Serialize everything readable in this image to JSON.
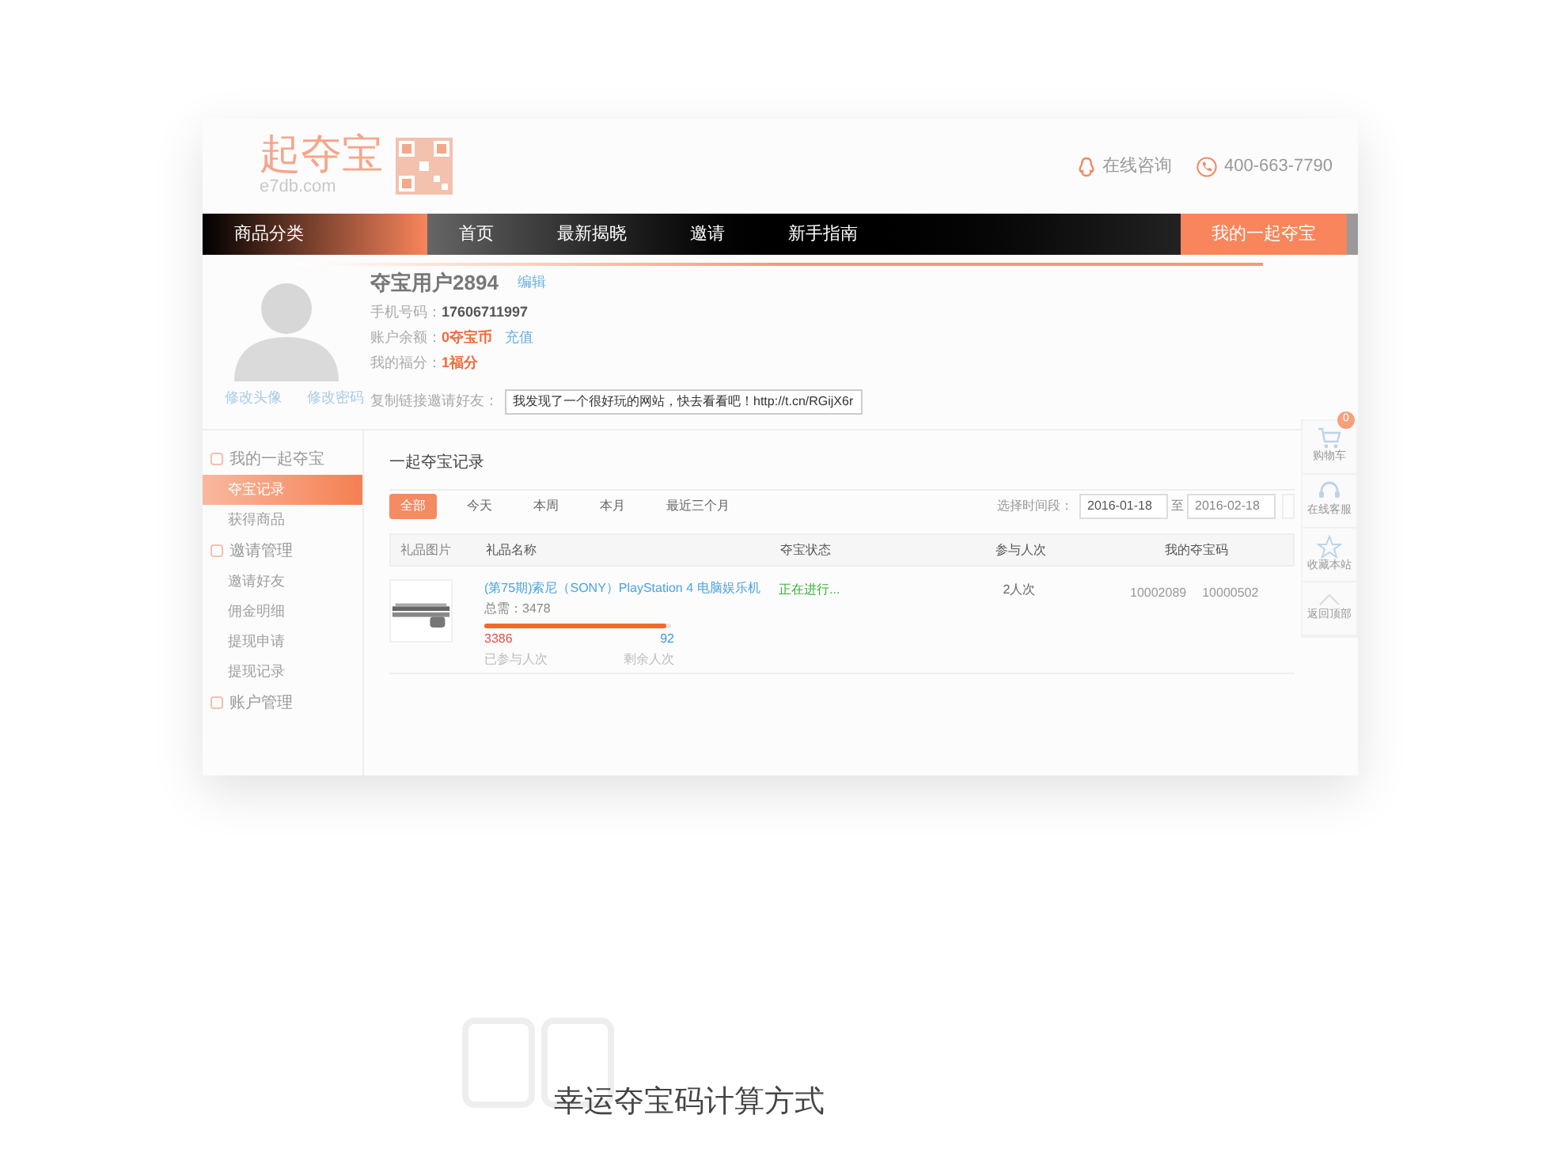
{
  "header": {
    "logo_text": "起夺宝",
    "logo_domain": "e7db.com",
    "consult": "在线咨询",
    "phone": "400-663-7790"
  },
  "nav": {
    "category": "商品分类",
    "items": [
      {
        "label": "首页"
      },
      {
        "label": "最新揭晓"
      },
      {
        "label": "邀请"
      },
      {
        "label": "新手指南"
      }
    ],
    "account": "我的一起夺宝"
  },
  "profile": {
    "username": "夺宝用户2894",
    "edit": "编辑",
    "avatar_links": [
      "修改头像",
      "修改密码"
    ],
    "fields": [
      {
        "kind": "plain",
        "label": "手机号码：",
        "value": "17606711997"
      },
      {
        "kind": "link",
        "label": "账户余额：",
        "value": "0夺宝币",
        "link": "充值"
      },
      {
        "kind": "accent",
        "label": "我的福分：",
        "value": "1福分"
      }
    ],
    "invite_label": "复制链接邀请好友：",
    "invite_value": "我发现了一个很好玩的网站，快去看看吧！http://t.cn/RGijX6r"
  },
  "sidebar": [
    {
      "label": "我的一起夺宝",
      "children": [
        {
          "label": "夺宝记录",
          "selected": true
        },
        {
          "label": "获得商品",
          "selected": false
        }
      ]
    },
    {
      "label": "邀请管理",
      "children": [
        {
          "label": "邀请好友",
          "selected": false
        },
        {
          "label": "佣金明细",
          "selected": false
        },
        {
          "label": "提现申请",
          "selected": false
        },
        {
          "label": "提现记录",
          "selected": false
        }
      ]
    },
    {
      "label": "账户管理"
    }
  ],
  "records": {
    "title": "一起夺宝记录",
    "filters": [
      {
        "label": "全部",
        "selected": true
      },
      {
        "label": "今天",
        "selected": false
      },
      {
        "label": "本周",
        "selected": false
      },
      {
        "label": "本月",
        "selected": false
      },
      {
        "label": "最近三个月",
        "selected": false
      }
    ],
    "date_label": "选择时间段：",
    "date_from": "2016-01-18",
    "date_sep": "至",
    "date_to": "2016-02-18",
    "columns": [
      "礼品图片",
      "礼品名称",
      "夺宝状态",
      "参与人次",
      "我的夺宝码"
    ],
    "rows": [
      {
        "name": "(第75期)索尼（SONY）PlayStation 4 电脑娱乐机",
        "total": "总需：3478",
        "level": 0.974,
        "joined": "3386",
        "remaining": "92",
        "joined_label": "已参与人次",
        "remaining_label": "剩余人次",
        "status": "正在进行...",
        "count": "2人次",
        "codes": [
          "10002089",
          "10000502"
        ]
      }
    ]
  },
  "side_tools": [
    {
      "label": "购物车",
      "badge": "0"
    },
    {
      "label": "在线客服"
    },
    {
      "label": "收藏本站"
    },
    {
      "label": "返回顶部"
    }
  ],
  "caption": "幸运夺宝码计算方式"
}
